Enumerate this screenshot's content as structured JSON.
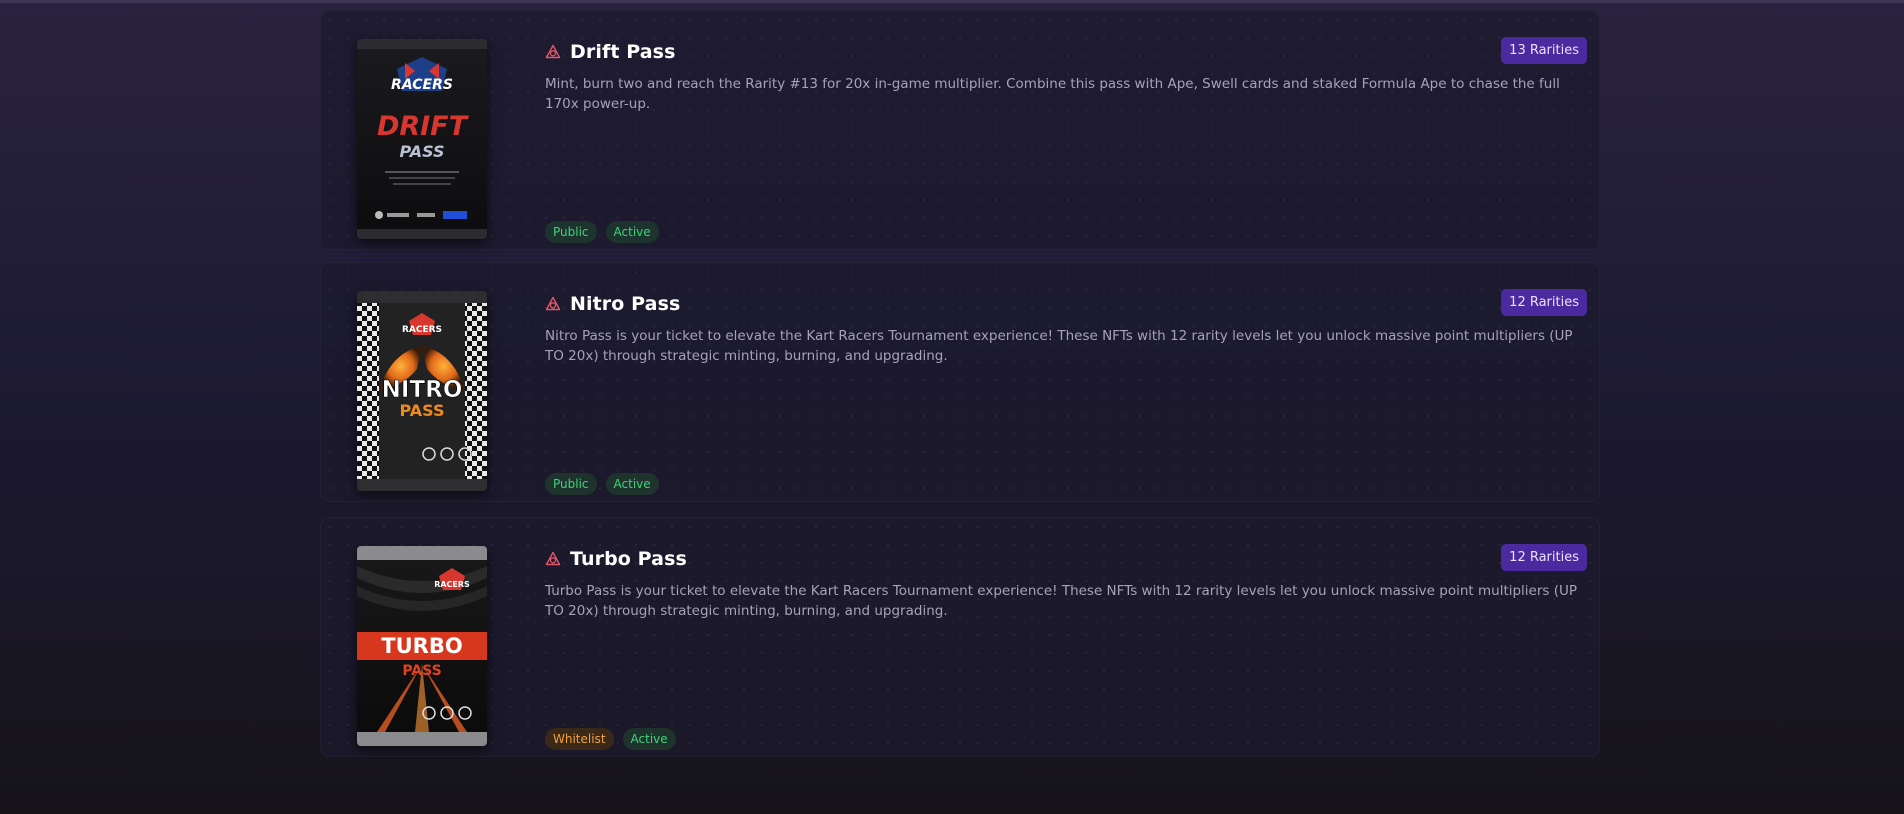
{
  "passes": [
    {
      "title": "Drift Pass",
      "rarities": "13 Rarities",
      "description": "Mint, burn two and reach the Rarity #13 for 20x in-game multiplier. Combine this pass with Ape, Swell cards and staked Formula Ape to chase the full 170x power-up.",
      "tags": [
        "Public",
        "Active"
      ],
      "pack": {
        "brand": "RACERS",
        "name": "DRIFT",
        "sub": "PASS",
        "accent": "#d7372f"
      }
    },
    {
      "title": "Nitro Pass",
      "rarities": "12 Rarities",
      "description": "Nitro Pass is your ticket to elevate the Kart Racers Tournament experience! These NFTs with 12 rarity levels let you unlock massive point multipliers (UP TO 20x) through strategic minting, burning, and upgrading.",
      "tags": [
        "Public",
        "Active"
      ],
      "pack": {
        "brand": "RACERS",
        "name": "NITRO",
        "sub": "PASS",
        "accent": "#f08a1c"
      }
    },
    {
      "title": "Turbo Pass",
      "rarities": "12 Rarities",
      "description": "Turbo Pass is your ticket to elevate the Kart Racers Tournament experience! These NFTs with 12 rarity levels let you unlock massive point multipliers (UP TO 20x) through strategic minting, burning, and upgrading.",
      "tags": [
        "Whitelist",
        "Active"
      ],
      "pack": {
        "brand": "RACERS",
        "name": "TURBO",
        "sub": "PASS",
        "accent": "#e2401f"
      }
    }
  ],
  "colors": {
    "badge": "#4b2aa0",
    "tag_green": "#3fd37a",
    "tag_orange": "#f0a23b",
    "icon": "#e0566a"
  },
  "icons": {
    "title_icon": "triangle-knot-icon"
  }
}
